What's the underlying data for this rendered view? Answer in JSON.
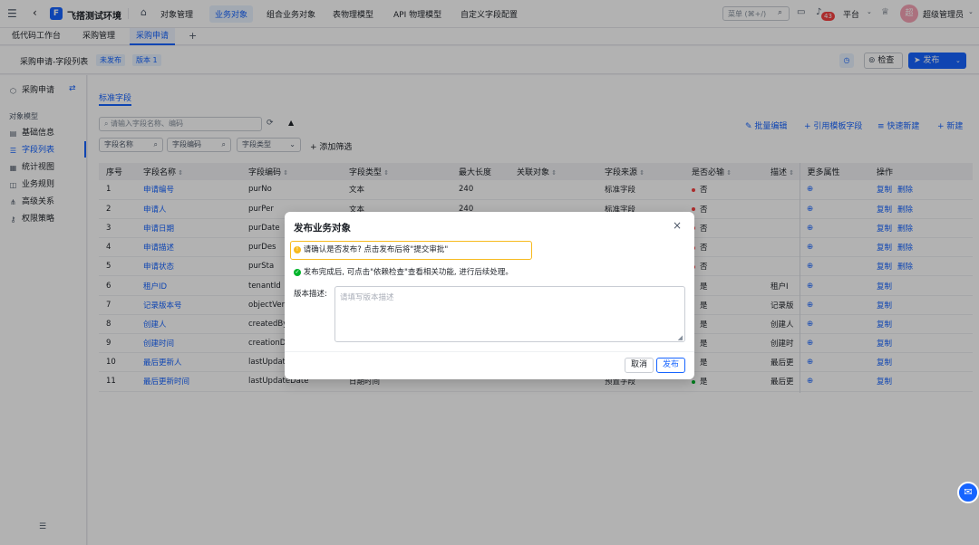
{
  "topbar": {
    "app_title": "飞搭测试环境",
    "nav": [
      "对象管理",
      "业务对象",
      "组合业务对象",
      "表物理模型",
      "API 物理模型",
      "自定义字段配置"
    ],
    "search_placeholder": "菜单 (⌘+/)",
    "notif_count": "43",
    "platform_label": "平台",
    "avatar_char": "超",
    "user_name": "超级管理员"
  },
  "tabs": [
    "低代码工作台",
    "采购管理",
    "采购申请"
  ],
  "pagehdr": {
    "title": "采购申请-字段列表",
    "status_badge": "未发布",
    "version_badge": "版本 1",
    "check_label": "检查",
    "publish_label": "发布"
  },
  "sidebar": {
    "title": "采购申请",
    "section": "对象模型",
    "items": [
      "基础信息",
      "字段列表",
      "统计视图",
      "业务规则",
      "高级关系",
      "权限策略"
    ]
  },
  "main": {
    "tab": "标准字段",
    "search_placeholder": "请输入字段名称、编码",
    "filters": [
      "字段名称",
      "字段编码",
      "字段类型"
    ],
    "add_filter": "添加筛选",
    "actions": [
      "批量编辑",
      "引用模板字段",
      "快速新建",
      "新建"
    ]
  },
  "table": {
    "headers": [
      "序号",
      "字段名称",
      "字段编码",
      "字段类型",
      "最大长度",
      "关联对象",
      "字段来源",
      "是否必输",
      "描述",
      "更多属性",
      "操作"
    ],
    "rows": [
      {
        "no": "1",
        "name": "申请编号",
        "code": "purNo",
        "type": "文本",
        "len": "240",
        "rel": "",
        "src": "标准字段",
        "req": "否",
        "reqdot": "#f53f3f",
        "desc": "",
        "ops": [
          "复制",
          "删除"
        ]
      },
      {
        "no": "2",
        "name": "申请人",
        "code": "purPer",
        "type": "文本",
        "len": "240",
        "rel": "",
        "src": "标准字段",
        "req": "否",
        "reqdot": "#f53f3f",
        "desc": "",
        "ops": [
          "复制",
          "删除"
        ]
      },
      {
        "no": "3",
        "name": "申请日期",
        "code": "purDate",
        "type": "",
        "len": "",
        "rel": "",
        "src": "",
        "req": "否",
        "reqdot": "#f53f3f",
        "desc": "",
        "ops": [
          "复制",
          "删除"
        ]
      },
      {
        "no": "4",
        "name": "申请描述",
        "code": "purDes",
        "type": "",
        "len": "",
        "rel": "",
        "src": "",
        "req": "否",
        "reqdot": "#f53f3f",
        "desc": "",
        "ops": [
          "复制",
          "删除"
        ]
      },
      {
        "no": "5",
        "name": "申请状态",
        "code": "purSta",
        "type": "",
        "len": "",
        "rel": "",
        "src": "",
        "req": "否",
        "reqdot": "#f53f3f",
        "desc": "",
        "ops": [
          "复制",
          "删除"
        ]
      },
      {
        "no": "6",
        "name": "租户ID",
        "code": "tenantId",
        "type": "",
        "len": "",
        "rel": "",
        "src": "",
        "req": "是",
        "reqdot": "",
        "desc": "租户I",
        "ops": [
          "复制"
        ]
      },
      {
        "no": "7",
        "name": "记录版本号",
        "code": "objectVer",
        "type": "",
        "len": "",
        "rel": "",
        "src": "",
        "req": "是",
        "reqdot": "",
        "desc": "记录版",
        "ops": [
          "复制"
        ]
      },
      {
        "no": "8",
        "name": "创建人",
        "code": "createdBy",
        "type": "",
        "len": "",
        "rel": "",
        "src": "",
        "req": "是",
        "reqdot": "",
        "desc": "创建人",
        "ops": [
          "复制"
        ]
      },
      {
        "no": "9",
        "name": "创建时间",
        "code": "creationD",
        "type": "",
        "len": "",
        "rel": "",
        "src": "",
        "req": "是",
        "reqdot": "",
        "desc": "创建时",
        "ops": [
          "复制"
        ]
      },
      {
        "no": "10",
        "name": "最后更新人",
        "code": "lastUpdate",
        "type": "",
        "len": "",
        "rel": "",
        "src": "",
        "req": "是",
        "reqdot": "",
        "desc": "最后更",
        "ops": [
          "复制"
        ]
      },
      {
        "no": "11",
        "name": "最后更新时间",
        "code": "lastUpdateDate",
        "type": "日期时间",
        "len": "",
        "rel": "",
        "src": "预置字段",
        "req": "是",
        "reqdot": "#00b42a",
        "desc": "最后更",
        "ops": [
          "复制"
        ]
      }
    ]
  },
  "dialog": {
    "title": "发布业务对象",
    "warning": "请确认是否发布? 点击发布后将\"提交审批\"",
    "info": "发布完成后, 可点击\"依赖检查\"查看相关功能, 进行后续处理。",
    "desc_label": "版本描述:",
    "desc_placeholder": "请填写版本描述",
    "cancel": "取消",
    "confirm": "发布"
  },
  "colors": {
    "accent": "#1664ff",
    "warn": "#f7ba1e",
    "success": "#00b42a",
    "danger": "#f53f3f"
  }
}
